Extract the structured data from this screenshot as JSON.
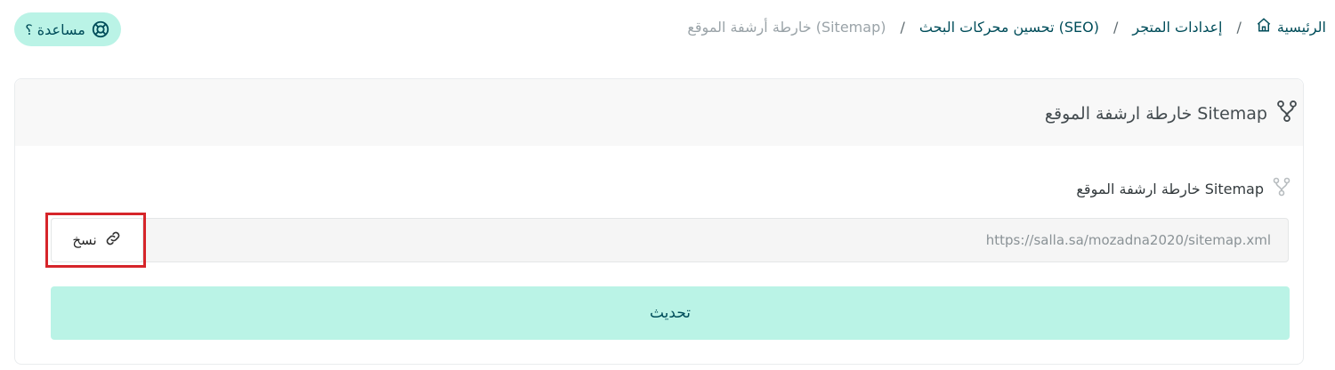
{
  "header": {
    "help_label": "مساعدة ؟",
    "help_icon": "lifebuoy-icon"
  },
  "breadcrumb": {
    "items": [
      {
        "label": "الرئيسية",
        "icon": "home-icon"
      },
      {
        "label": "إعدادات المتجر"
      },
      {
        "label": "تحسين محركات البحث (SEO)"
      },
      {
        "label": "خارطة أرشفة الموقع (Sitemap)"
      }
    ],
    "separator": "/"
  },
  "card": {
    "title": "خارطة ارشفة الموقع Sitemap",
    "title_icon": "sitemap-icon",
    "section_label": "خارطة ارشفة الموقع Sitemap",
    "section_icon": "sitemap-icon",
    "url_value": "https://salla.sa/mozadna2020/sitemap.xml",
    "copy_label": "نسخ",
    "copy_icon": "link-icon",
    "update_label": "تحديث"
  },
  "colors": {
    "accent_bg": "#baf3e6",
    "accent_text": "#004d5a",
    "highlight": "#d6252a"
  }
}
